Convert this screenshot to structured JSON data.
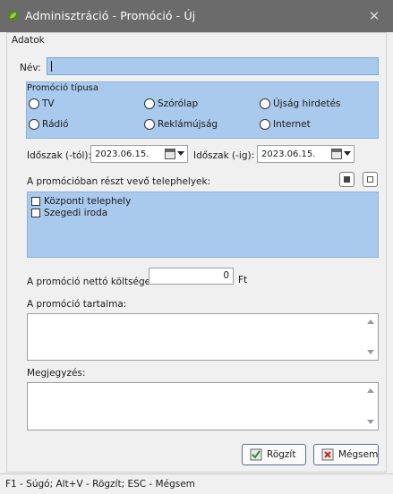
{
  "window": {
    "title": "Adminisztráció - Promóció - Új",
    "close_glyph": "✕",
    "icon": "app-leaf-icon",
    "accent": "#a9c9ed"
  },
  "group_title": "Adatok",
  "name": {
    "label": "Név:",
    "value": ""
  },
  "promo_type": {
    "title": "Promóció típusa",
    "options": [
      "TV",
      "Szórólap",
      "Újság hirdetés",
      "Rádió",
      "Reklámújság",
      "Internet"
    ]
  },
  "period": {
    "from_label": "Időszak (-tól):",
    "from_value": "2023.06.15.",
    "to_label": "Időszak (-ig):",
    "to_value": "2023.06.15."
  },
  "locations": {
    "label": "A promócióban részt vevő telephelyek:",
    "items": [
      "Központi telephely",
      "Szegedi iroda"
    ]
  },
  "cost": {
    "label": "A promóció nettó költsége:",
    "value": "0",
    "unit": "Ft"
  },
  "content": {
    "label": "A promóció tartalma:",
    "value": ""
  },
  "note": {
    "label": "Megjegyzés:",
    "value": ""
  },
  "buttons": {
    "save": "Rögzít",
    "cancel": "Mégsem"
  },
  "status": "F1 - Súgó; Alt+V - Rögzít; ESC - Mégsem"
}
